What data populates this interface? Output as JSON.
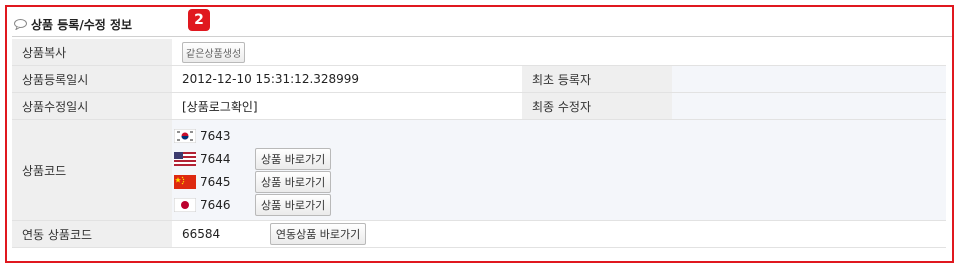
{
  "section": {
    "title": "상품 등록/수정 정보",
    "badge": "2"
  },
  "rows": {
    "copy": {
      "label": "상품복사",
      "button": "같은상품생성"
    },
    "created": {
      "label": "상품등록일시",
      "value": "2012-12-10 15:31:12.328999",
      "side_label": "최초 등록자",
      "side_value": ""
    },
    "modified": {
      "label": "상품수정일시",
      "value": "[상품로그확인]",
      "side_label": "최종 수정자",
      "side_value": ""
    },
    "codes": {
      "label": "상품코드",
      "items": [
        {
          "flag": "kr-flag-icon",
          "code": "7643",
          "button": ""
        },
        {
          "flag": "us-flag-icon",
          "code": "7644",
          "button": "상품 바로가기"
        },
        {
          "flag": "cn-flag-icon",
          "code": "7645",
          "button": "상품 바로가기"
        },
        {
          "flag": "jp-flag-icon",
          "code": "7646",
          "button": "상품 바로가기"
        }
      ]
    },
    "linked": {
      "label": "연동 상품코드",
      "value": "66584",
      "button": "연동상품 바로가기"
    }
  },
  "colors": {
    "highlight": "#e0181f",
    "label_bg": "#efefef"
  }
}
